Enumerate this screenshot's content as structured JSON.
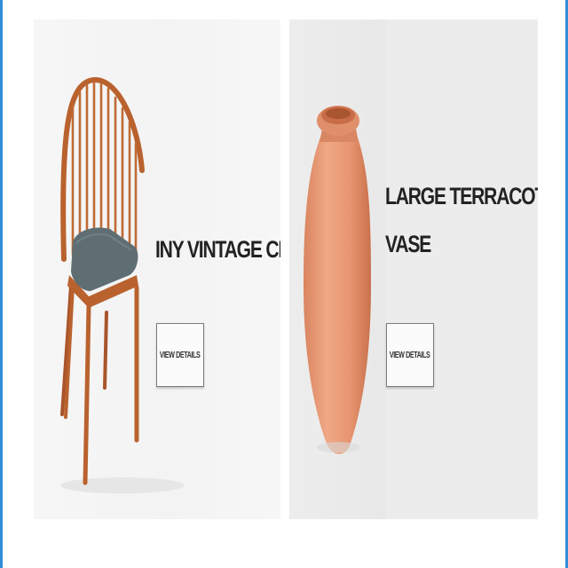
{
  "products": [
    {
      "title": "INY VINTAGE CHAIR",
      "button_label": "VIEW DETAILS",
      "image": "chair-image"
    },
    {
      "title_lines": [
        "LARGE TERRACOTA",
        "VASE"
      ],
      "button_label": "VIEW DETAILS",
      "image": "vase-image"
    }
  ],
  "colors": {
    "frame_border": "#2f8fd8",
    "chair_wood": "#b9622e",
    "chair_cushion": "#5f6e72",
    "vase_terracotta": "#e49a78"
  }
}
